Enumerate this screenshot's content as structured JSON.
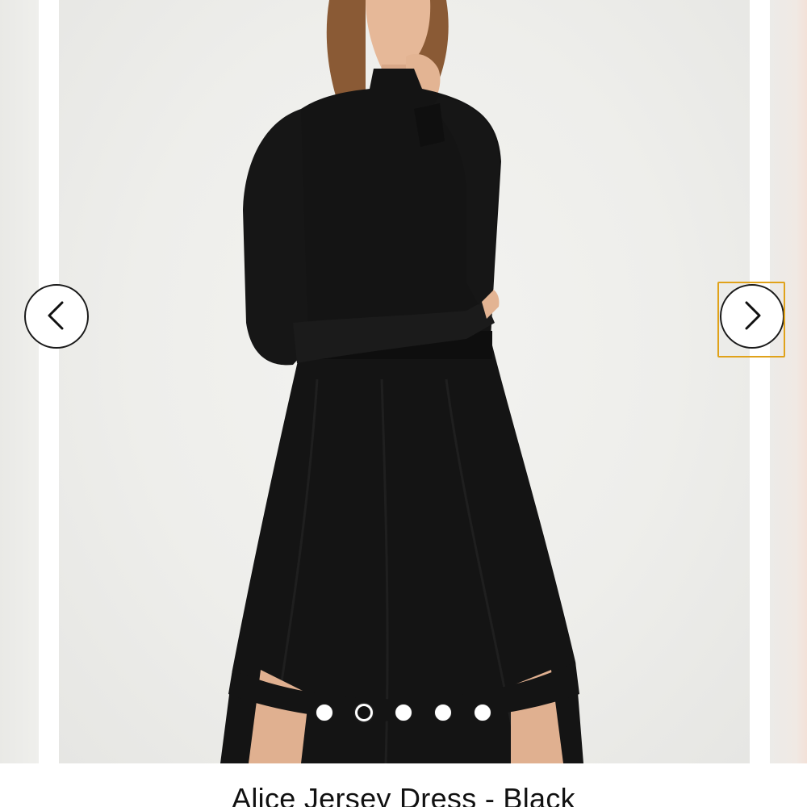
{
  "gallery": {
    "image_alt": "Woman wearing a black long-sleeve jersey dress with high neck",
    "prev_icon": "chevron-left-icon",
    "next_icon": "chevron-right-icon",
    "slide_count": 5,
    "active_index": 1,
    "focus_color": "#e0a21a"
  },
  "product": {
    "title": "Alice Jersey Dress - Black"
  }
}
